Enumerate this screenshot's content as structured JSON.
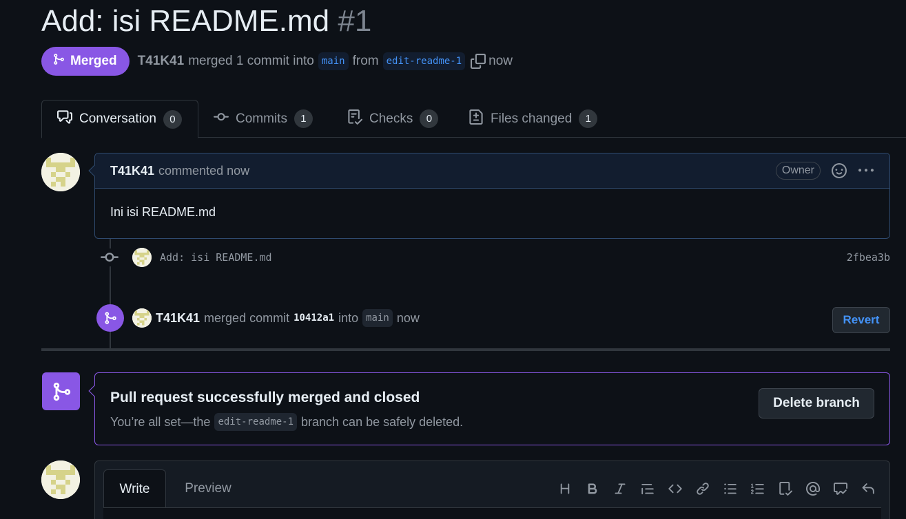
{
  "pr": {
    "title": "Add: isi README.md",
    "number": "#1",
    "state": "Merged",
    "author": "T41K41",
    "summary_text": "merged 1 commit into",
    "base_branch": "main",
    "from_text": "from",
    "head_branch": "edit-readme-1",
    "time": "now"
  },
  "tabs": [
    {
      "label": "Conversation",
      "count": "0"
    },
    {
      "label": "Commits",
      "count": "1"
    },
    {
      "label": "Checks",
      "count": "0"
    },
    {
      "label": "Files changed",
      "count": "1"
    }
  ],
  "comment": {
    "author": "T41K41",
    "action": "commented now",
    "role": "Owner",
    "body": "Ini isi README.md"
  },
  "commit": {
    "message": "Add: isi README.md",
    "sha": "2fbea3b"
  },
  "merge_event": {
    "author": "T41K41",
    "text_before": "merged commit",
    "sha": "10412a1",
    "text_into": "into",
    "branch": "main",
    "time": "now",
    "revert_label": "Revert"
  },
  "merged_box": {
    "title": "Pull request successfully merged and closed",
    "sub_before": "You’re all set—the",
    "branch": "edit-readme-1",
    "sub_after": "branch can be safely deleted.",
    "delete_label": "Delete branch"
  },
  "composer": {
    "write_label": "Write",
    "preview_label": "Preview",
    "toolbar": [
      "heading-icon",
      "bold-icon",
      "italic-icon",
      "quote-icon",
      "code-icon",
      "link-icon",
      "bullet-list-icon",
      "numbered-list-icon",
      "task-list-icon",
      "mention-icon",
      "reference-icon",
      "reply-icon"
    ]
  },
  "colors": {
    "background": "#0d1117",
    "merged_purple": "#8957e5",
    "link_blue": "#4493f8",
    "border": "#30363d",
    "muted_text": "#9198a1"
  }
}
